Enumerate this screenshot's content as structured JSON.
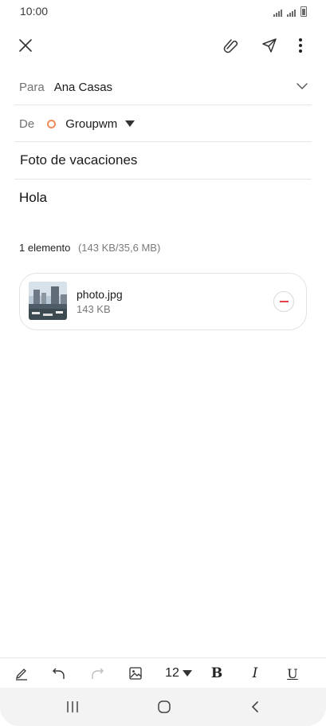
{
  "status_bar": {
    "time": "10:00"
  },
  "header": {
    "icons": [
      "close-icon",
      "paperclip-icon",
      "send-icon",
      "more-vertical-icon"
    ]
  },
  "compose": {
    "to_label": "Para",
    "to_value": "Ana Casas",
    "from_label": "De",
    "from_value": "Groupwm",
    "subject": "Foto de vacaciones",
    "body": "Hola"
  },
  "attachments": {
    "summary_count": "1 elemento",
    "summary_size": "(143 KB/35,6 MB)",
    "items": [
      {
        "name": "photo.jpg",
        "size": "143 KB"
      }
    ]
  },
  "toolbar": {
    "font_size": "12",
    "bold": "B",
    "italic": "I",
    "underline": "U"
  },
  "colors": {
    "accent": "#f08b5a",
    "remove": "#e2434b"
  }
}
